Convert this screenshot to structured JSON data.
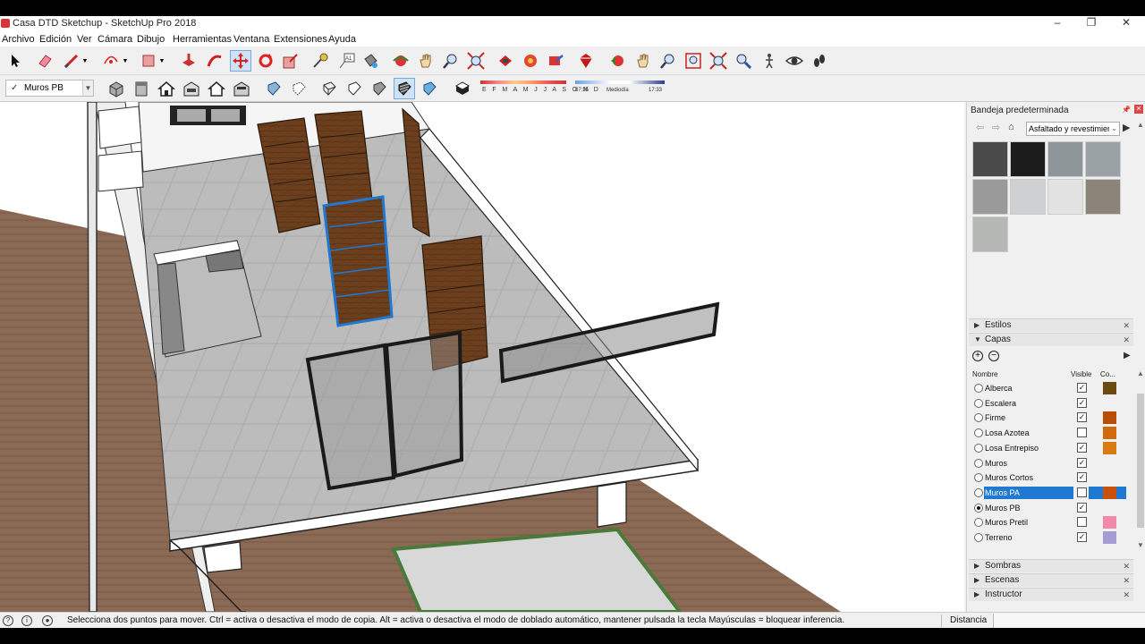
{
  "window": {
    "title": "Casa DTD Sketchup - SketchUp Pro 2018",
    "min": "–",
    "max": "❐",
    "close": "✕"
  },
  "menu": [
    "Archivo",
    "Edición",
    "Ver",
    "Cámara",
    "Dibujo",
    "Herramientas",
    "Ventana",
    "Extensiones",
    "Ayuda"
  ],
  "toolbar": {
    "layer_select": "Muros PB",
    "months_label": "E F M A M J J A S O N D",
    "time_start": "07:35",
    "time_mid": "Mediodía",
    "time_end": "17:33"
  },
  "tray": {
    "title": "Bandeja predeterminada",
    "materials_select": "Asfaltado y revestimier",
    "swatch_colors": [
      "#4a4a4a",
      "#1c1c1c",
      "#8e9699",
      "#9ba2a5",
      "#9a9a9a",
      "#cfd0d2",
      "#e2e2e2",
      "#8a8578",
      "#b5b7b5"
    ],
    "panels": {
      "estilos": "Estilos",
      "capas": "Capas",
      "sombras": "Sombras",
      "escenas": "Escenas",
      "instructor": "Instructor"
    },
    "layers_header": {
      "name": "Nombre",
      "visible": "Visible",
      "color": "Co..."
    },
    "layers": [
      {
        "name": "Alberca",
        "visible": true,
        "color": "#6b4a12",
        "active": false,
        "selected": false
      },
      {
        "name": "Escalera",
        "visible": true,
        "color": "",
        "active": false,
        "selected": false
      },
      {
        "name": "Firme",
        "visible": true,
        "color": "#b84f06",
        "active": false,
        "selected": false
      },
      {
        "name": "Losa Azotea",
        "visible": false,
        "color": "#d26a0d",
        "active": false,
        "selected": false
      },
      {
        "name": "Losa Entrepiso",
        "visible": true,
        "color": "#d97a12",
        "active": false,
        "selected": false
      },
      {
        "name": "Muros",
        "visible": true,
        "color": "",
        "active": false,
        "selected": false
      },
      {
        "name": "Muros Cortos",
        "visible": true,
        "color": "",
        "active": false,
        "selected": false
      },
      {
        "name": "Muros PA",
        "visible": false,
        "color": "#c9500a",
        "active": false,
        "selected": true
      },
      {
        "name": "Muros PB",
        "visible": true,
        "color": "",
        "active": true,
        "selected": false
      },
      {
        "name": "Muros Pretil",
        "visible": false,
        "color": "#f08aa8",
        "active": false,
        "selected": false
      },
      {
        "name": "Terreno",
        "visible": true,
        "color": "#a49cd2",
        "active": false,
        "selected": false
      }
    ]
  },
  "status": {
    "message": "Selecciona dos puntos para mover. Ctrl = activa o desactiva el modo de copia. Alt = activa o desactiva el modo de doblado automático, mantener pulsada la tecla Mayúsculas = bloquear inferencia.",
    "distance_label": "Distancia"
  },
  "colors": {
    "selection": "#1f78d1",
    "door_wood": "#6b3f1d",
    "floor": "#b2b2b2"
  }
}
